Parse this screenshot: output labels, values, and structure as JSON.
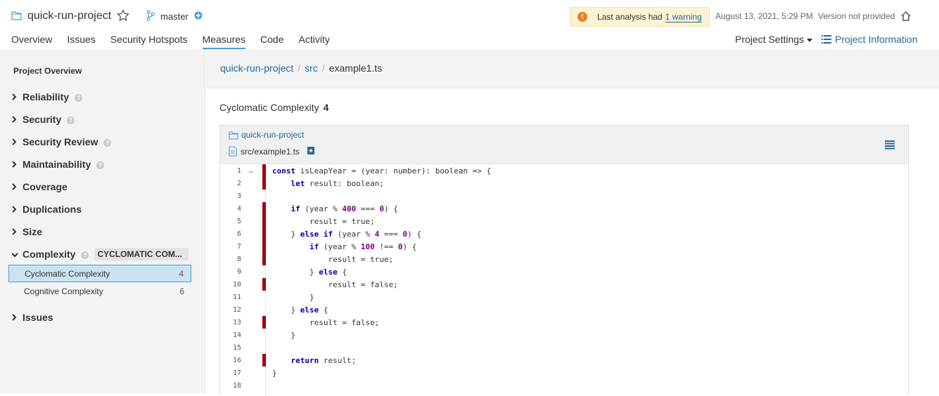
{
  "header": {
    "project_name": "quick-run-project",
    "branch": "master",
    "warning_prefix": "Last analysis had",
    "warning_link": "1 warning",
    "analysis_date": "August 13, 2021, 5:29 PM",
    "version": "Version not provided",
    "accent_color": "#4b9fd5",
    "warning_color": "#ed7d20"
  },
  "nav": {
    "tabs": [
      "Overview",
      "Issues",
      "Security Hotspots",
      "Measures",
      "Code",
      "Activity"
    ],
    "active": "Measures",
    "project_settings": "Project Settings",
    "project_information": "Project Information"
  },
  "sidebar": {
    "title": "Project Overview",
    "domains": [
      "Reliability",
      "Security",
      "Security Review",
      "Maintainability",
      "Coverage",
      "Duplications",
      "Size",
      "Complexity",
      "Issues"
    ],
    "complexity_badge": "CYCLOMATIC COM...",
    "measures": [
      {
        "label": "Cyclomatic Complexity",
        "value": "4"
      },
      {
        "label": "Cognitive Complexity",
        "value": "6"
      }
    ]
  },
  "breadcrumb": {
    "items": [
      "quick-run-project",
      "src",
      "example1.ts"
    ]
  },
  "metric": {
    "label": "Cyclomatic Complexity",
    "value": "4"
  },
  "viewer": {
    "project": "quick-run-project",
    "file": "src/example1.ts",
    "more_dots": "…",
    "coverage_color": "#a4030f",
    "lines": [
      {
        "n": "1",
        "marked": true
      },
      {
        "n": "2",
        "marked": true
      },
      {
        "n": "3",
        "marked": false
      },
      {
        "n": "4",
        "marked": true
      },
      {
        "n": "5",
        "marked": true
      },
      {
        "n": "6",
        "marked": true
      },
      {
        "n": "7",
        "marked": true
      },
      {
        "n": "8",
        "marked": true
      },
      {
        "n": "9",
        "marked": false
      },
      {
        "n": "10",
        "marked": true
      },
      {
        "n": "11",
        "marked": false
      },
      {
        "n": "12",
        "marked": false
      },
      {
        "n": "13",
        "marked": true
      },
      {
        "n": "14",
        "marked": false
      },
      {
        "n": "15",
        "marked": false
      },
      {
        "n": "16",
        "marked": true
      },
      {
        "n": "17",
        "marked": false
      },
      {
        "n": "18",
        "marked": false
      }
    ],
    "code": [
      [
        [
          "kw",
          "const"
        ],
        [
          "t",
          " isLeapYear = (year: number): boolean => {"
        ]
      ],
      [
        [
          "t",
          "    "
        ],
        [
          "kw",
          "let"
        ],
        [
          "t",
          " result: boolean;"
        ]
      ],
      [],
      [
        [
          "t",
          "    "
        ],
        [
          "kw",
          "if"
        ],
        [
          "t",
          " (year % "
        ],
        [
          "num",
          "400"
        ],
        [
          "t",
          " === "
        ],
        [
          "num",
          "0"
        ],
        [
          "t",
          ") {"
        ]
      ],
      [
        [
          "t",
          "        result = true;"
        ]
      ],
      [
        [
          "t",
          "    } "
        ],
        [
          "kw",
          "else if"
        ],
        [
          "t",
          " (year % "
        ],
        [
          "num",
          "4"
        ],
        [
          "t",
          " === "
        ],
        [
          "num",
          "0"
        ],
        [
          "t",
          ") {"
        ]
      ],
      [
        [
          "t",
          "        "
        ],
        [
          "kw",
          "if"
        ],
        [
          "t",
          " (year % "
        ],
        [
          "num",
          "100"
        ],
        [
          "t",
          " !== "
        ],
        [
          "num",
          "0"
        ],
        [
          "t",
          ") {"
        ]
      ],
      [
        [
          "t",
          "            result = true;"
        ]
      ],
      [
        [
          "t",
          "        } "
        ],
        [
          "kw",
          "else"
        ],
        [
          "t",
          " {"
        ]
      ],
      [
        [
          "t",
          "            result = false;"
        ]
      ],
      [
        [
          "t",
          "        }"
        ]
      ],
      [
        [
          "t",
          "    } "
        ],
        [
          "kw",
          "else"
        ],
        [
          "t",
          " {"
        ]
      ],
      [
        [
          "t",
          "        result = false;"
        ]
      ],
      [
        [
          "t",
          "    }"
        ]
      ],
      [],
      [
        [
          "t",
          "    "
        ],
        [
          "kw",
          "return"
        ],
        [
          "t",
          " result;"
        ]
      ],
      [
        [
          "t",
          "}"
        ]
      ],
      []
    ]
  }
}
